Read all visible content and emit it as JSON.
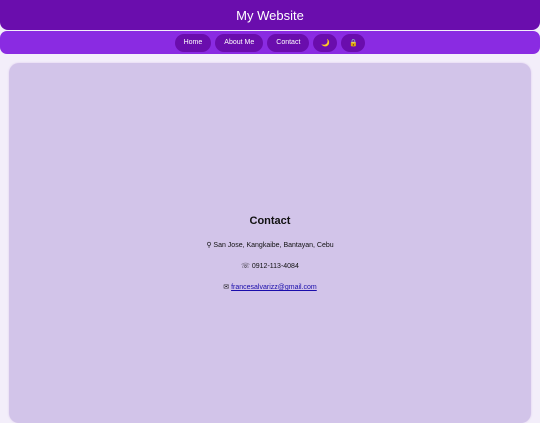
{
  "header": {
    "title": "My Website"
  },
  "nav": {
    "items": [
      {
        "label": "Home"
      },
      {
        "label": "About Me"
      },
      {
        "label": "Contact"
      }
    ],
    "theme_toggle_icon": "moon-icon",
    "theme_toggle_glyph": "🌙",
    "lock_icon": "lock-icon",
    "lock_glyph": "🔒"
  },
  "contact": {
    "heading": "Contact",
    "address_glyph": "⚲",
    "address": "San Jose, Kangkaibe, Bantayan, Cebu",
    "phone_glyph": "☏",
    "phone": "0912-113-4084",
    "email_glyph": "✉",
    "email": "francesalvarizz@gmail.com"
  },
  "colors": {
    "header": "#6a0dad",
    "nav": "#8a2be2",
    "card": "#d2c4e9",
    "page": "#f3eefa"
  }
}
